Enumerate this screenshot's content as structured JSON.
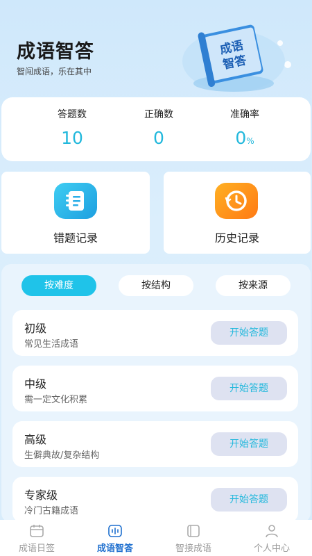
{
  "header": {
    "title": "成语智答",
    "subtitle": "智闯成语，乐在其中",
    "illustration_text": "成语\n智答"
  },
  "stats": [
    {
      "label": "答题数",
      "value": "10"
    },
    {
      "label": "正确数",
      "value": "0"
    },
    {
      "label": "准确率",
      "value": "0",
      "unit": "%"
    }
  ],
  "features": {
    "wrong": {
      "label": "错题记录",
      "icon": "notebook-icon",
      "color": "#2cb8ea"
    },
    "history": {
      "label": "历史记录",
      "icon": "clock-history-icon",
      "color": "#ff8a1e"
    }
  },
  "tabs": {
    "difficulty": "按难度",
    "structure": "按结构",
    "source": "按来源",
    "active": "按难度"
  },
  "levels": [
    {
      "name": "初级",
      "desc": "常见生活成语",
      "button": "开始答题"
    },
    {
      "name": "中级",
      "desc": "需一定文化积累",
      "button": "开始答题"
    },
    {
      "name": "高级",
      "desc": "生僻典故/复杂结构",
      "button": "开始答题"
    },
    {
      "name": "专家级",
      "desc": "冷门古籍成语",
      "button": "开始答题"
    }
  ],
  "tabbar": [
    {
      "label": "成语日签",
      "icon": "calendar-icon",
      "active": false
    },
    {
      "label": "成语智答",
      "icon": "voice-wave-icon",
      "active": true
    },
    {
      "label": "智接成语",
      "icon": "book-icon",
      "active": false
    },
    {
      "label": "个人中心",
      "icon": "user-icon",
      "active": false
    }
  ],
  "colors": {
    "accent": "#1fc3e9",
    "value_text": "#22b8dc",
    "tab_active_text": "#1e6fcf"
  }
}
